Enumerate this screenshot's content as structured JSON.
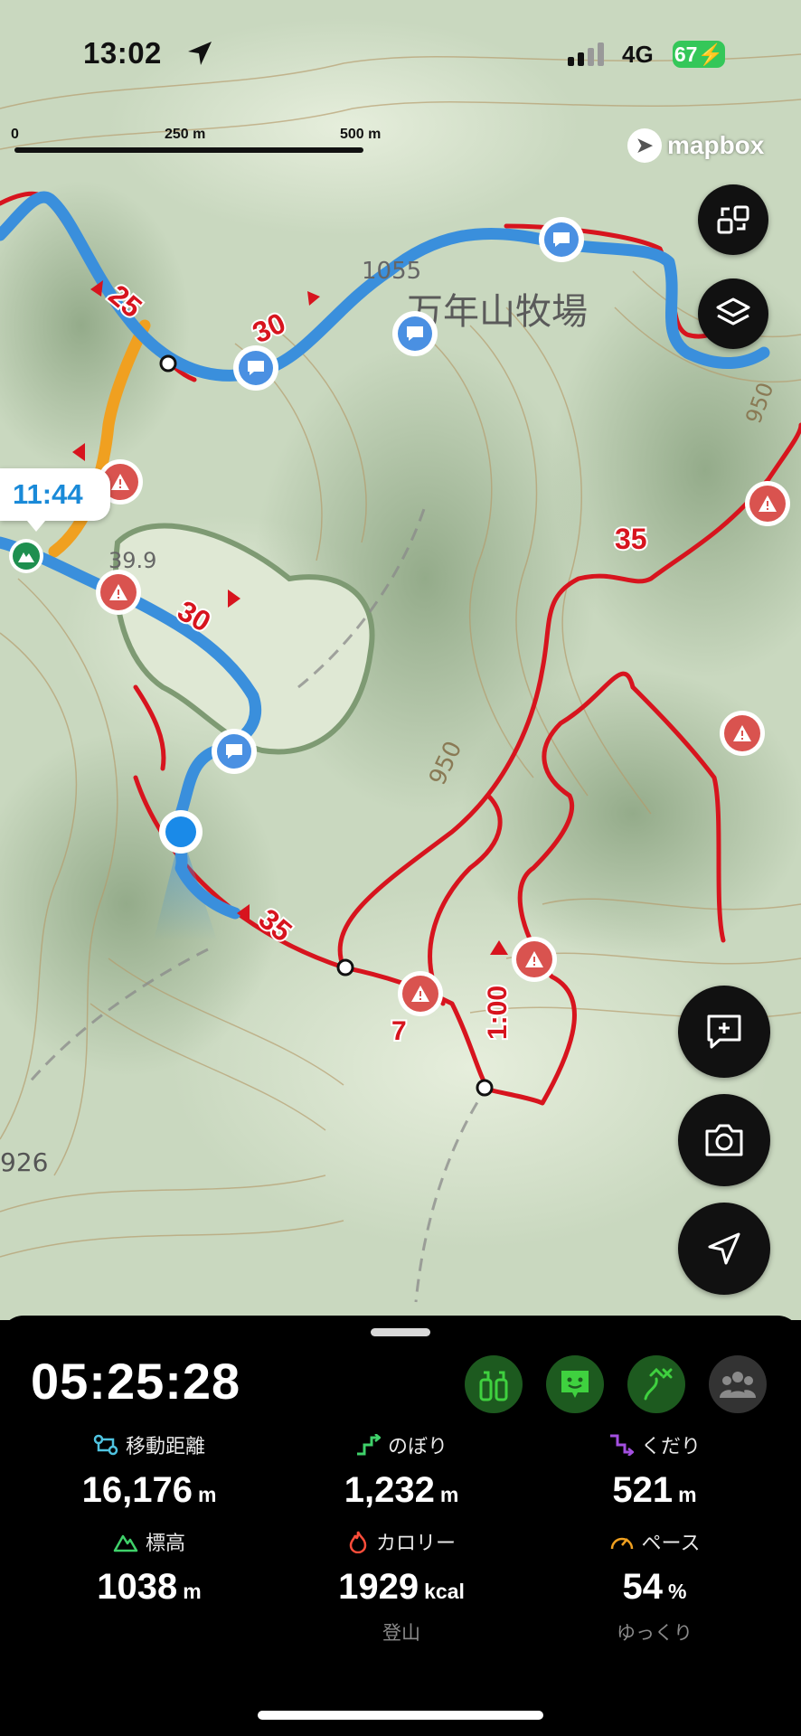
{
  "status_bar": {
    "time": "13:02",
    "network": "4G",
    "battery": "67"
  },
  "map": {
    "scale": {
      "labels": [
        "0",
        "250 m",
        "500 m"
      ]
    },
    "attribution": "mapbox",
    "place_name": "万年山牧場",
    "elevation_labels": [
      "1055",
      "39.9",
      "950",
      "950",
      "926"
    ],
    "route_labels": [
      "25",
      "30",
      "30",
      "35",
      "35",
      "7",
      "1:00"
    ],
    "time_marker": "11:44"
  },
  "panel": {
    "elapsed_time": "05:25:28",
    "stats": [
      {
        "label": "移動距離",
        "value": "16,176",
        "unit": "m"
      },
      {
        "label": "のぼり",
        "value": "1,232",
        "unit": "m"
      },
      {
        "label": "くだり",
        "value": "521",
        "unit": "m"
      },
      {
        "label": "標高",
        "value": "1038",
        "unit": "m"
      },
      {
        "label": "カロリー",
        "value": "1929",
        "unit": "kcal",
        "sub": "登山"
      },
      {
        "label": "ペース",
        "value": "54",
        "unit": "%",
        "sub": "ゆっくり"
      }
    ],
    "colors": {
      "route_blue": "#3a8fdc",
      "route_red": "#d7141e",
      "route_orange": "#f0a020",
      "accent_green": "#1d5a1f"
    }
  }
}
